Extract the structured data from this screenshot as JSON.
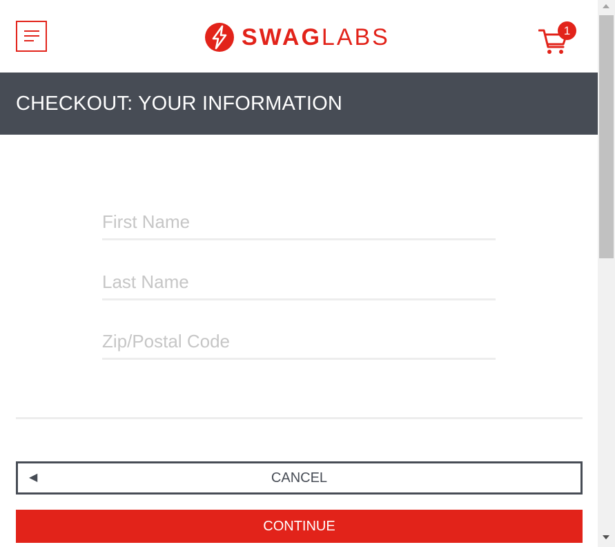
{
  "header": {
    "logo_swag": "SWAG",
    "logo_labs": "LABS",
    "cart_count": "1",
    "menu_icon": "hamburger-menu-icon",
    "cart_icon": "shopping-cart-icon"
  },
  "page": {
    "title": "CHECKOUT: YOUR INFORMATION"
  },
  "form": {
    "first_name": {
      "value": "",
      "placeholder": "First Name"
    },
    "last_name": {
      "value": "",
      "placeholder": "Last Name"
    },
    "postal_code": {
      "value": "",
      "placeholder": "Zip/Postal Code"
    }
  },
  "actions": {
    "cancel_label": "CANCEL",
    "cancel_icon": "left-arrow-icon",
    "continue_label": "CONTINUE"
  },
  "colors": {
    "brand_red": "#e2231a",
    "header_dark": "#474c55",
    "field_line": "#ededed",
    "placeholder": "#c6c6c6"
  }
}
